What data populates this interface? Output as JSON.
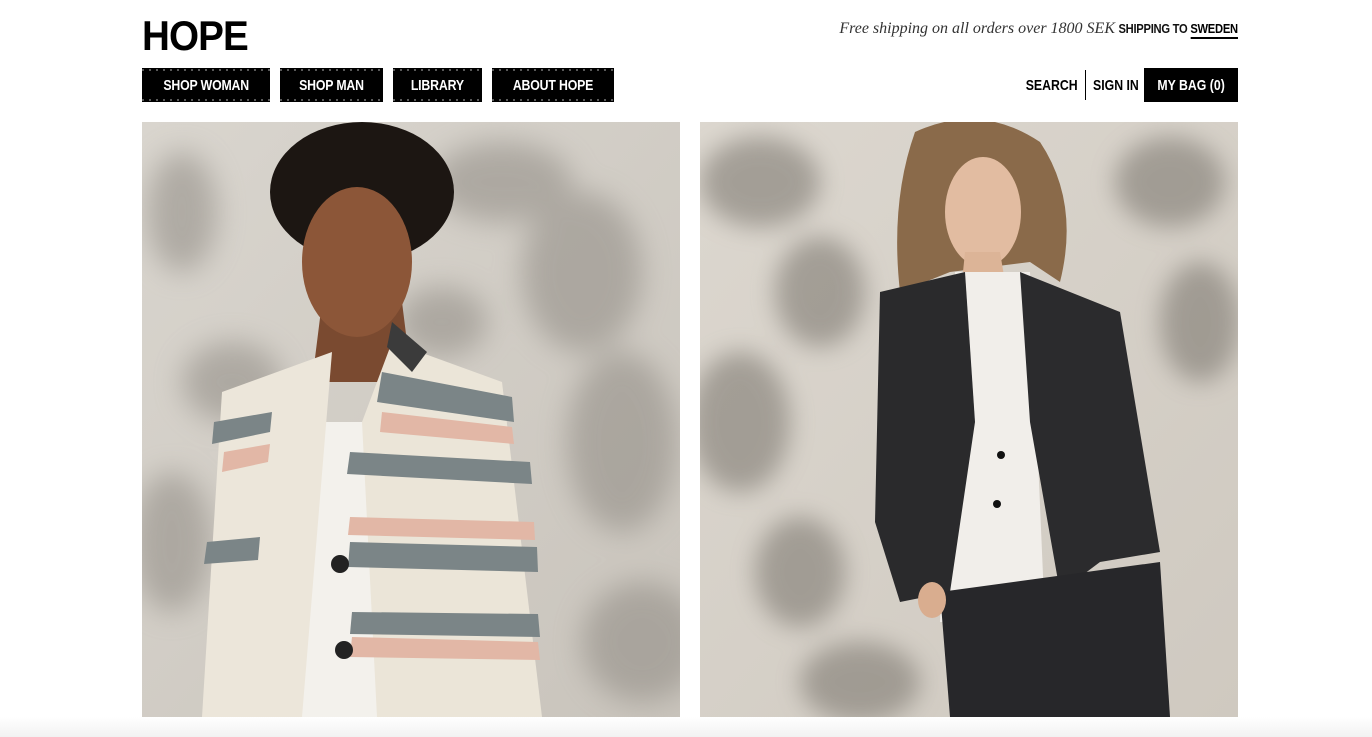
{
  "brand": {
    "logo_text": "HOPE"
  },
  "header": {
    "promo_text": "Free shipping on all orders over 1800 SEK",
    "shipping_label": "SHIPPING TO",
    "shipping_country": "SWEDEN"
  },
  "nav": {
    "items": [
      {
        "label": "SHOP WOMAN"
      },
      {
        "label": "SHOP MAN"
      },
      {
        "label": "LIBRARY"
      },
      {
        "label": "ABOUT HOPE"
      }
    ],
    "search_label": "SEARCH",
    "signin_label": "SIGN IN",
    "bag_label": "MY BAG (0)"
  },
  "colors": {
    "brand_black": "#000000",
    "background": "#ffffff",
    "photo_backdrop": "#d6d2cb"
  },
  "hero": {
    "left_image": "woman-striped-jacket-photo",
    "right_image": "man-dark-suit-photo"
  }
}
